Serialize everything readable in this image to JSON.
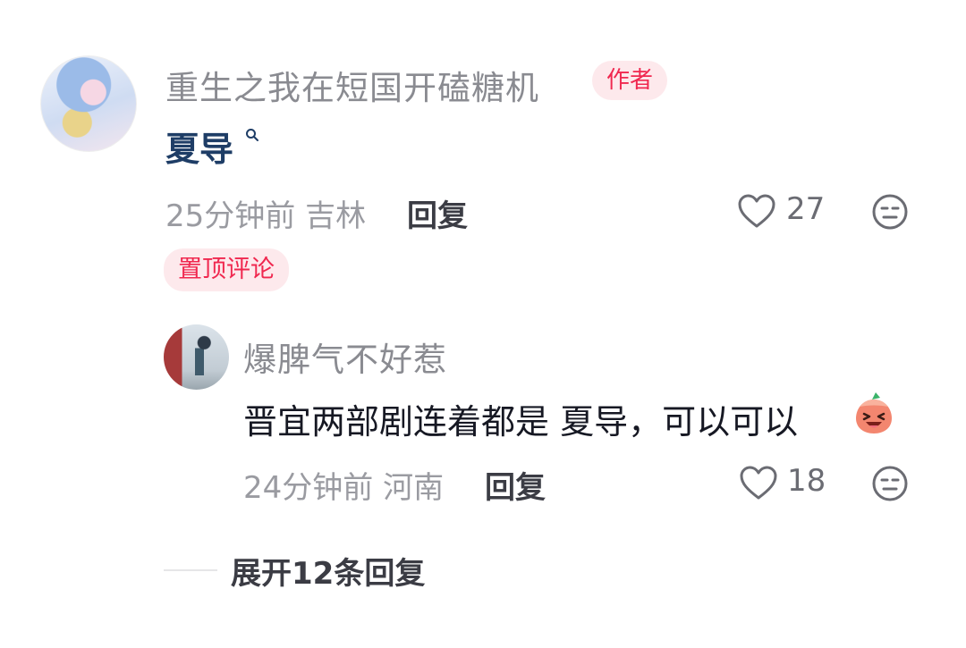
{
  "comment": {
    "username": "重生之我在短国开磕糖机",
    "author_badge": "作者",
    "text": "夏导",
    "time": "25分钟前",
    "location": "吉林",
    "reply_label": "回复",
    "likes": "27",
    "pinned_label": "置顶评论"
  },
  "reply": {
    "username": "爆脾气不好惹",
    "text": "晋宜两部剧连着都是 夏导，可以可以",
    "time": "24分钟前",
    "location": "河南",
    "reply_label": "回复",
    "likes": "18"
  },
  "expand_label": "展开12条回复",
  "colors": {
    "accent": "#f0284f",
    "badge_bg": "#fde9ec",
    "link": "#1e3d66",
    "secondary_text": "#9a9ba1"
  },
  "icons": [
    "search-icon",
    "heart-icon",
    "dislike-face-icon",
    "laughing-emoji-icon"
  ]
}
